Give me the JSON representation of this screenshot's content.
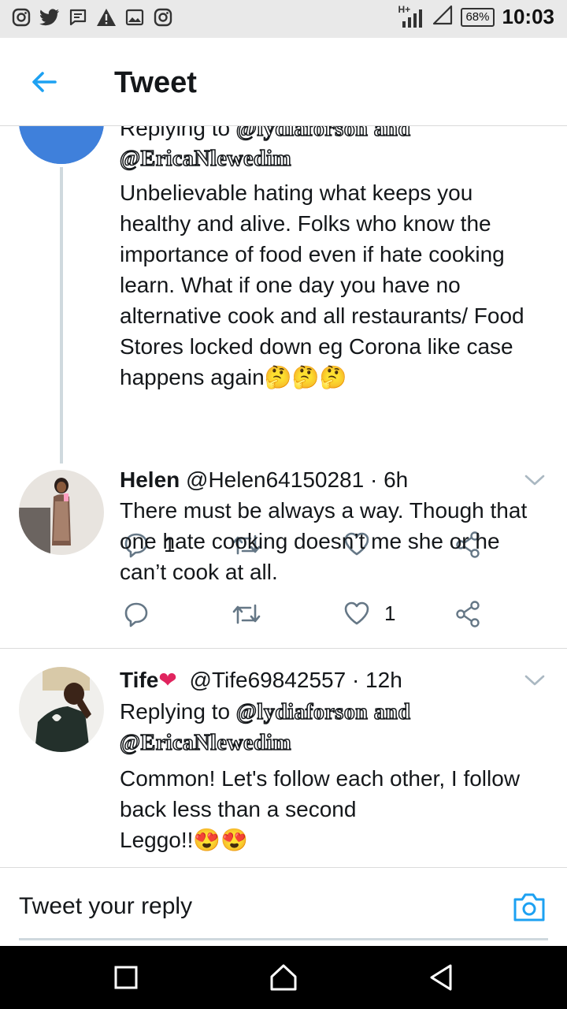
{
  "status_bar": {
    "left_icons": [
      "instagram-icon",
      "twitter-icon",
      "message-icon",
      "warning-icon",
      "image-icon",
      "instagram-icon"
    ],
    "network": "H+",
    "battery": "68%",
    "time": "10:03"
  },
  "header": {
    "back_icon": "arrow-left-icon",
    "title": "Tweet"
  },
  "tweets": [
    {
      "replying_prefix": "Replying to",
      "replying_mentions": "@lydiaforson and",
      "mention_2": "@EricaNlewedim",
      "text": "Unbelievable hating what keeps you healthy and alive. Folks who know the importance of food even if hate cooking learn. What if one day you have no alternative cook and all restaurants/ Food Stores locked down eg Corona like case happens again",
      "emojis": "🤔🤔🤔",
      "reply_count": "1",
      "retweet_count": "",
      "like_count": ""
    },
    {
      "name": "Helen",
      "handle": "@Helen64150281",
      "time": "· 6h",
      "text": "There must be always a way. Though that one hate cooking doesn’t me she or he can’t cook at all.",
      "reply_count": "",
      "retweet_count": "",
      "like_count": "1"
    },
    {
      "name": "Tife",
      "name_emoji": "❤",
      "handle": "@Tife69842557",
      "time": "· 12h",
      "replying_prefix": "Replying to",
      "replying_mentions": "@lydiaforson and",
      "mention_2": "@EricaNlewedim",
      "text_line1": "Common! Let's follow each other, I follow back less than a second",
      "text_line2": "Leggo!!",
      "emojis": "😍😍"
    }
  ],
  "composer": {
    "placeholder": "Tweet your reply",
    "camera_icon": "camera-icon"
  },
  "nav_bar": {
    "buttons": [
      "recent-apps-button",
      "home-button",
      "back-button"
    ]
  },
  "colors": {
    "accent": "#1da1f2",
    "text": "#14171a",
    "thread_line": "#cfd9de",
    "heart": "#e0245e"
  }
}
